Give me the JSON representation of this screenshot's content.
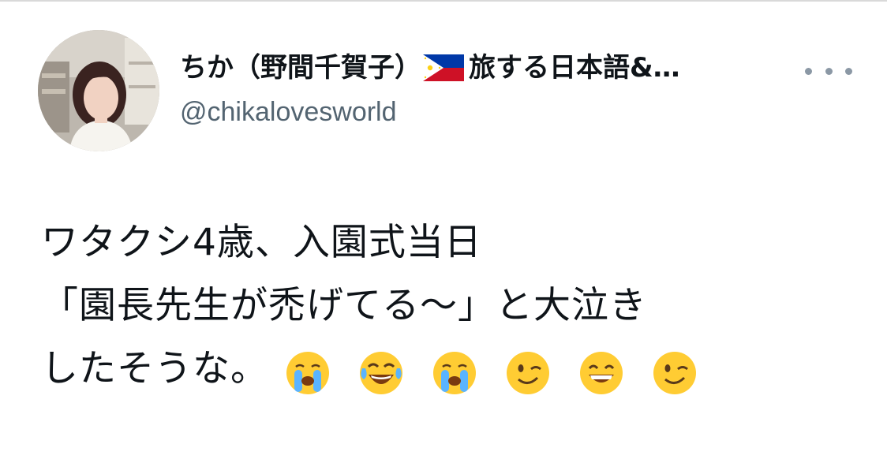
{
  "tweet": {
    "author": {
      "display_name_prefix": "ちか（野間千賀子）",
      "display_name_suffix": "旅する日本語&…",
      "handle": "@chikalovesworld",
      "flag_icon": "philippines-flag-icon",
      "avatar_icon": "profile-photo"
    },
    "more_icon": "more-horizontal-icon",
    "text_lines": [
      "ワタクシ4歳、入園式当日",
      "「園長先生が禿げてる〜」と大泣き",
      "したそうな。"
    ],
    "emojis": [
      "loudly-crying-face",
      "face-with-tears-of-joy",
      "loudly-crying-face",
      "winking-face",
      "grinning-face-with-smiling-eyes",
      "winking-face"
    ],
    "colors": {
      "text": "#0f1419",
      "handle": "#536471",
      "more_dots": "#8b98a5",
      "emoji_yellow": "#ffcc33"
    }
  }
}
